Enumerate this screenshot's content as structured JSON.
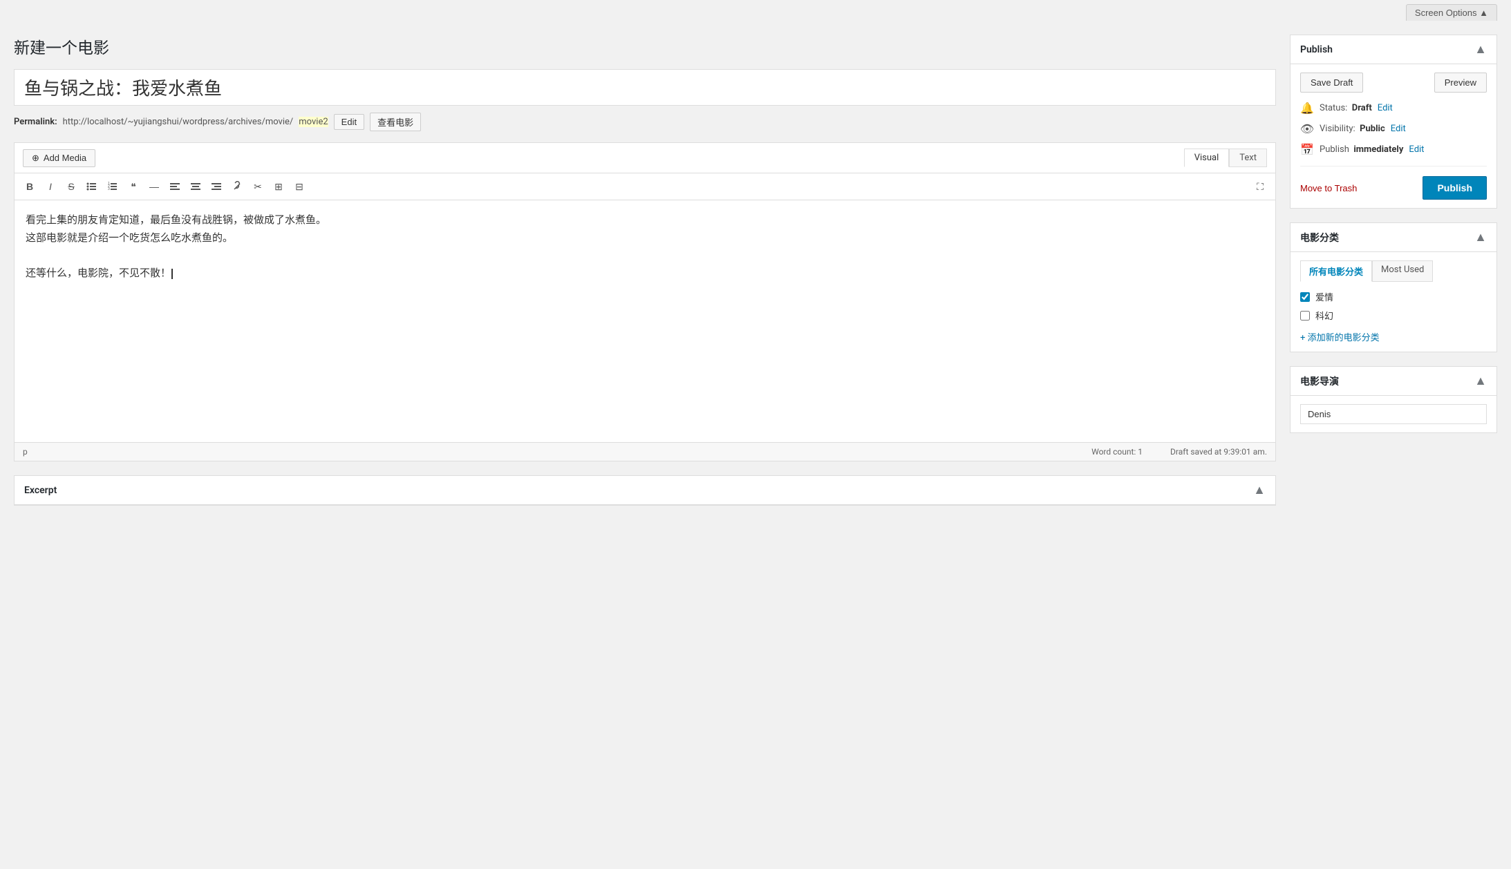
{
  "page": {
    "title": "新建一个电影",
    "screen_options_label": "Screen Options ▲"
  },
  "post": {
    "title": "鱼与锅之战：我爱水煮鱼",
    "permalink_label": "Permalink:",
    "permalink_base": "http://localhost/~yujiangshui/wordpress/archives/movie/",
    "permalink_slug": "movie2",
    "permalink_edit_btn": "Edit",
    "permalink_view_btn": "查看电影",
    "content_line1": "看完上集的朋友肯定知道，最后鱼没有战胜锅，被做成了水煮鱼。",
    "content_line2": "这部电影就是介绍一个吃货怎么吃水煮鱼的。",
    "content_line3": "",
    "content_line4": "还等什么，电影院，不见不散！",
    "word_count_label": "Word count: 1",
    "draft_saved": "Draft saved at 9:39:01 am.",
    "tag_p": "p"
  },
  "toolbar": {
    "add_media_label": "Add Media",
    "tab_visual": "Visual",
    "tab_text": "Text",
    "btn_bold": "B",
    "btn_italic": "I",
    "btn_strikethrough": "S̶",
    "btn_ul": "≡",
    "btn_ol": "≡",
    "btn_blockquote": "❝",
    "btn_hr": "—",
    "btn_align_left": "≡",
    "btn_align_center": "≡",
    "btn_align_right": "≡",
    "btn_link": "🔗",
    "btn_unlink": "✂",
    "btn_insert": "⊞",
    "btn_table": "⊟",
    "btn_fullscreen": "⛶"
  },
  "publish_panel": {
    "title": "Publish",
    "save_draft_label": "Save Draft",
    "preview_label": "Preview",
    "status_label": "Status:",
    "status_value": "Draft",
    "status_edit": "Edit",
    "visibility_label": "Visibility:",
    "visibility_value": "Public",
    "visibility_edit": "Edit",
    "publish_time_label": "Publish",
    "publish_time_value": "immediately",
    "publish_time_edit": "Edit",
    "move_to_trash_label": "Move to Trash",
    "publish_label": "Publish"
  },
  "category_panel": {
    "title": "电影分类",
    "tab_all": "所有电影分类",
    "tab_most_used": "Most Used",
    "categories": [
      {
        "name": "爱情",
        "checked": true
      },
      {
        "name": "科幻",
        "checked": false
      }
    ],
    "add_new_label": "+ 添加新的电影分类"
  },
  "director_panel": {
    "title": "电影导演",
    "value": "Denis"
  },
  "excerpt_box": {
    "title": "Excerpt"
  }
}
